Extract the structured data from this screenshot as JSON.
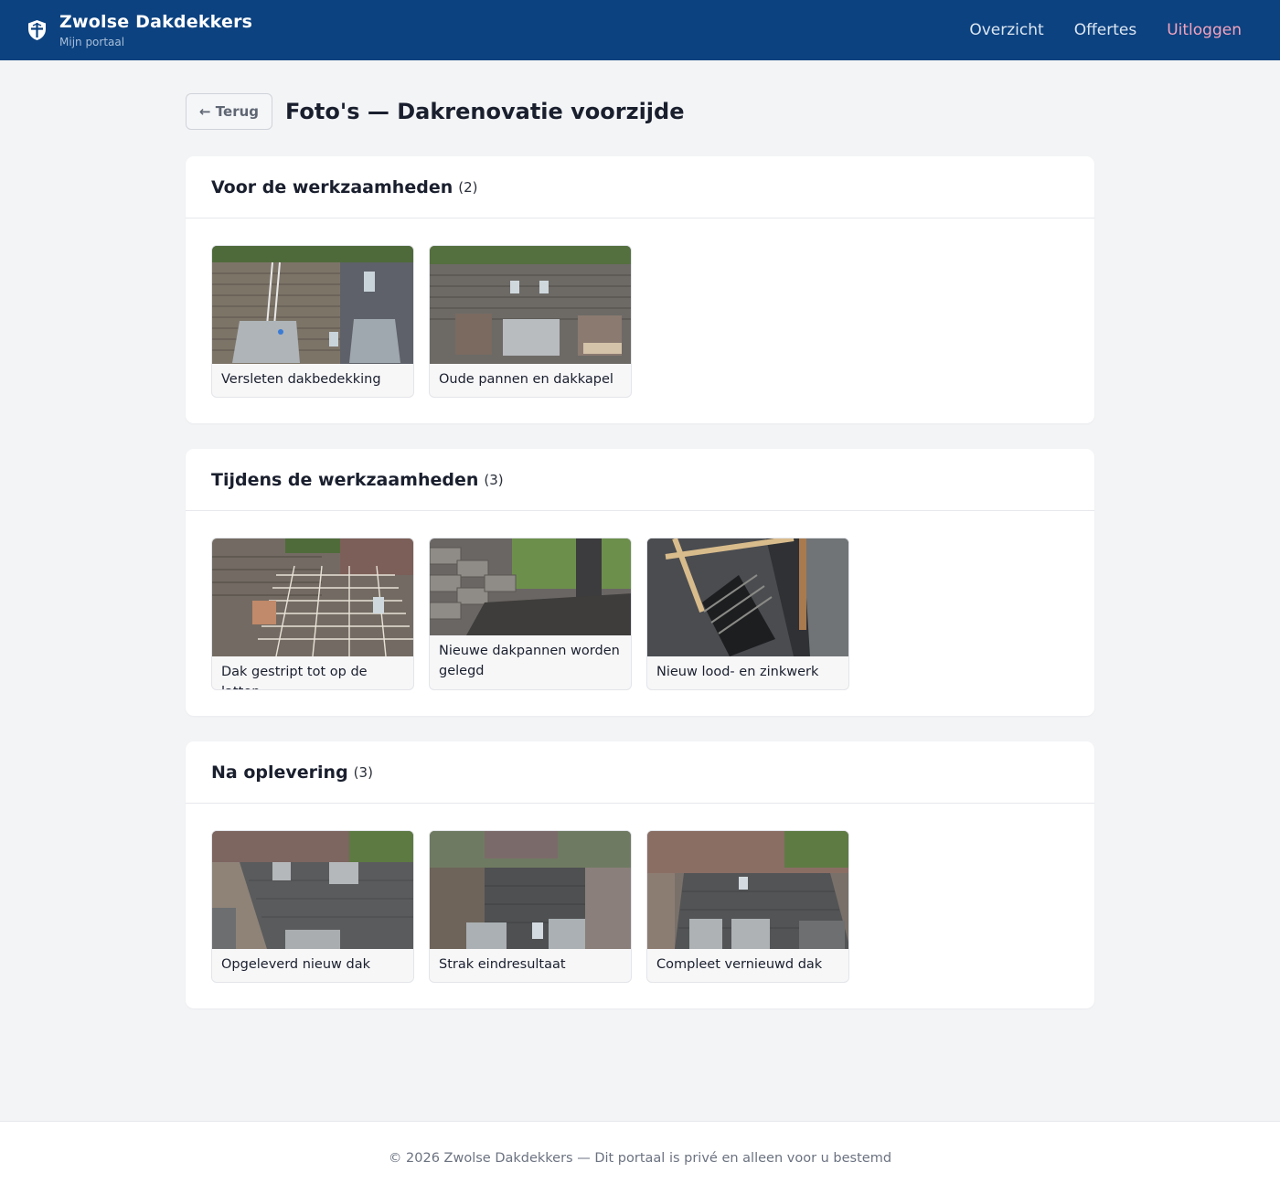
{
  "header": {
    "brand_name": "Zwolse Dakdekkers",
    "brand_sub": "Mijn portaal",
    "nav": [
      {
        "label": "Overzicht"
      },
      {
        "label": "Offertes"
      },
      {
        "label": "Uitloggen"
      }
    ],
    "bg_color": "#0c4280",
    "logout_color": "#f5a3bd"
  },
  "page": {
    "back_label": "← Terug",
    "title": "Foto's — Dakrenovatie voorzijde"
  },
  "sections": [
    {
      "title": "Voor de werkzaamheden",
      "count": "(2)",
      "photos": [
        {
          "caption": "Versleten dakbedekking"
        },
        {
          "caption": "Oude pannen en dakkapel"
        }
      ]
    },
    {
      "title": "Tijdens de werkzaamheden",
      "count": "(3)",
      "photos": [
        {
          "caption": "Dak gestript tot op de latten"
        },
        {
          "caption": "Nieuwe dakpannen worden gelegd"
        },
        {
          "caption": "Nieuw lood- en zinkwerk"
        }
      ]
    },
    {
      "title": "Na oplevering",
      "count": "(3)",
      "photos": [
        {
          "caption": "Opgeleverd nieuw dak"
        },
        {
          "caption": "Strak eindresultaat"
        },
        {
          "caption": "Compleet vernieuwd dak"
        }
      ]
    }
  ],
  "footer": {
    "text": "© 2026 Zwolse Dakdekkers — Dit portaal is privé en alleen voor u bestemd"
  }
}
